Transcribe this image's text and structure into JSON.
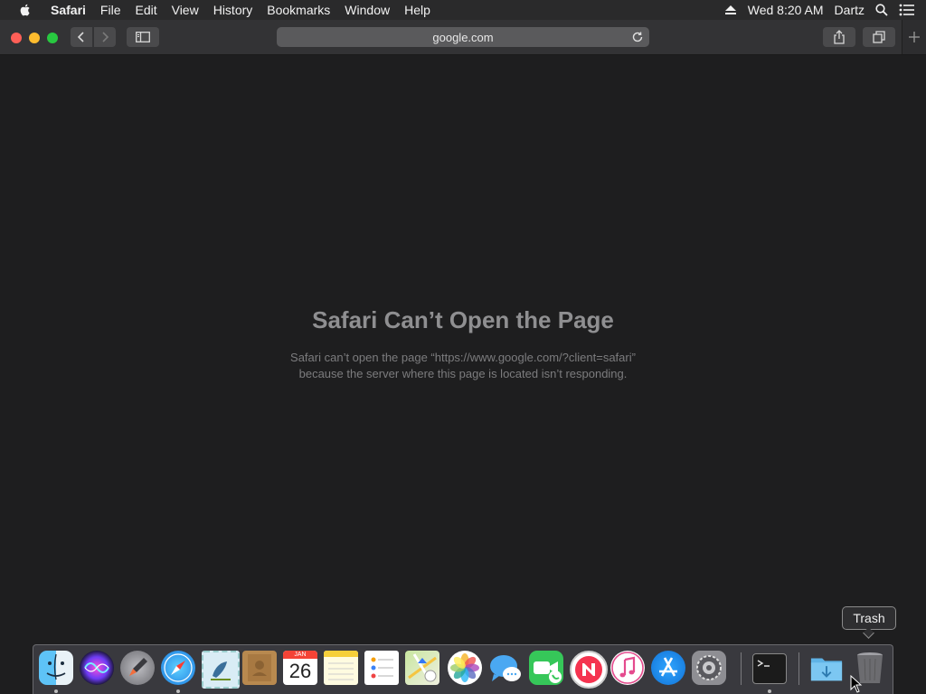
{
  "menubar": {
    "app_name": "Safari",
    "items": [
      "File",
      "Edit",
      "View",
      "History",
      "Bookmarks",
      "Window",
      "Help"
    ],
    "clock": "Wed 8:20 AM",
    "user": "Dartz"
  },
  "toolbar": {
    "url": "google.com"
  },
  "error": {
    "title": "Safari Can’t Open the Page",
    "line1": "Safari can’t open the page “https://www.google.com/?client=safari”",
    "line2": "because the server where this page is located isn’t responding."
  },
  "tooltip": {
    "text": "Trash"
  },
  "dock": {
    "calendar_month": "JAN",
    "calendar_day": "26",
    "apps": [
      "finder",
      "siri",
      "launchpad",
      "safari",
      "mail",
      "contacts",
      "calendar",
      "notes",
      "reminders",
      "maps",
      "photos",
      "messages",
      "facetime",
      "news",
      "itunes",
      "app-store",
      "system-preferences",
      "terminal",
      "downloads",
      "trash"
    ]
  },
  "colors": {
    "close": "#fe5f57",
    "minimize": "#febc2e",
    "zoom": "#28c840"
  }
}
